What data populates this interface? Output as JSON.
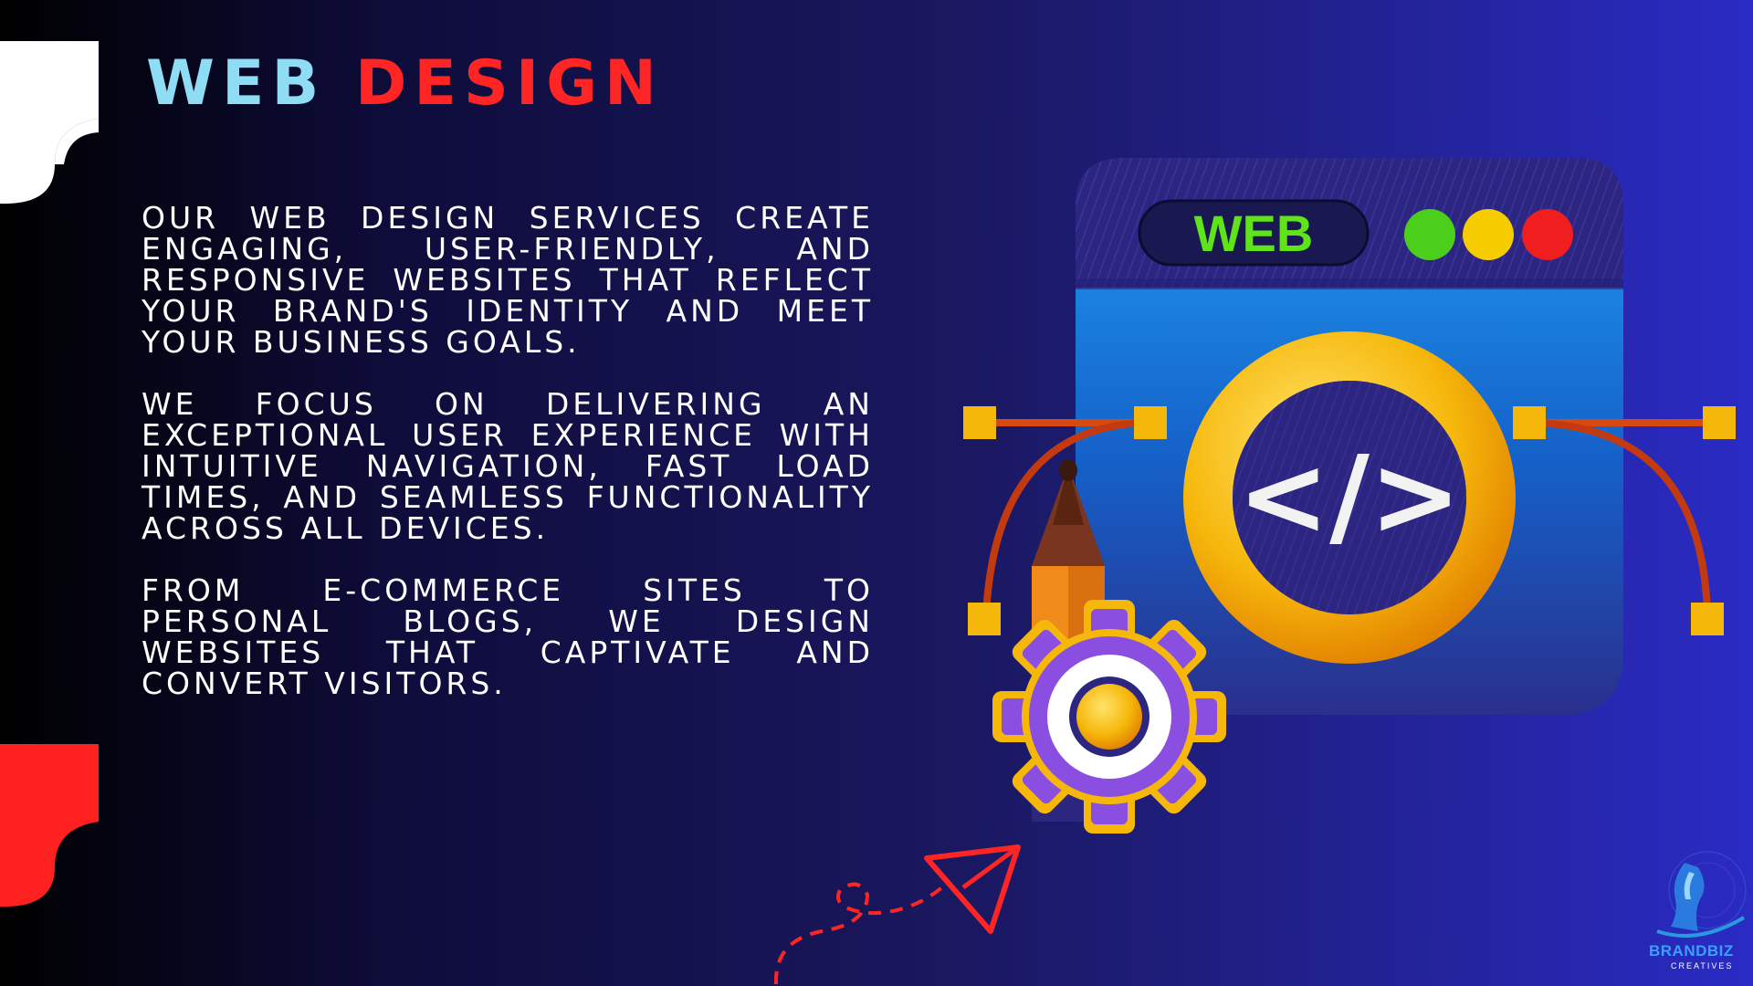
{
  "title": {
    "word1": "WEB",
    "word2": "DESIGN"
  },
  "paragraphs": [
    "OUR WEB DESIGN SERVICES CREATE ENGAGING, USER-FRIENDLY, AND RESPONSIVE WEBSITES THAT REFLECT YOUR BRAND'S IDENTITY AND MEET YOUR BUSINESS GOALS.",
    "WE FOCUS ON DELIVERING AN EXCEPTIONAL USER EXPERIENCE WITH INTUITIVE NAVIGATION, FAST LOAD TIMES, AND SEAMLESS FUNCTIONALITY ACROSS ALL DEVICES.",
    "FROM E-COMMERCE SITES TO PERSONAL BLOGS, WE DESIGN WEBSITES THAT CAPTIVATE AND CONVERT VISITORS."
  ],
  "illustration": {
    "browser_label": "WEB",
    "code_symbol": "</>"
  },
  "logo": {
    "line1": "BRANDBIZ",
    "line2": "CREATIVES"
  },
  "colors": {
    "accent_blue": "#8fdcf5",
    "accent_red": "#ff2525",
    "window_blue": "#1a8fe8",
    "gold": "#f6b70b",
    "purple": "#8a4fe0"
  },
  "icons": [
    "top-left-white-shape",
    "bottom-left-red-shape",
    "browser-window-icon",
    "code-icon",
    "pencil-icon",
    "gear-icon",
    "paper-plane-icon",
    "brand-logo-icon"
  ]
}
